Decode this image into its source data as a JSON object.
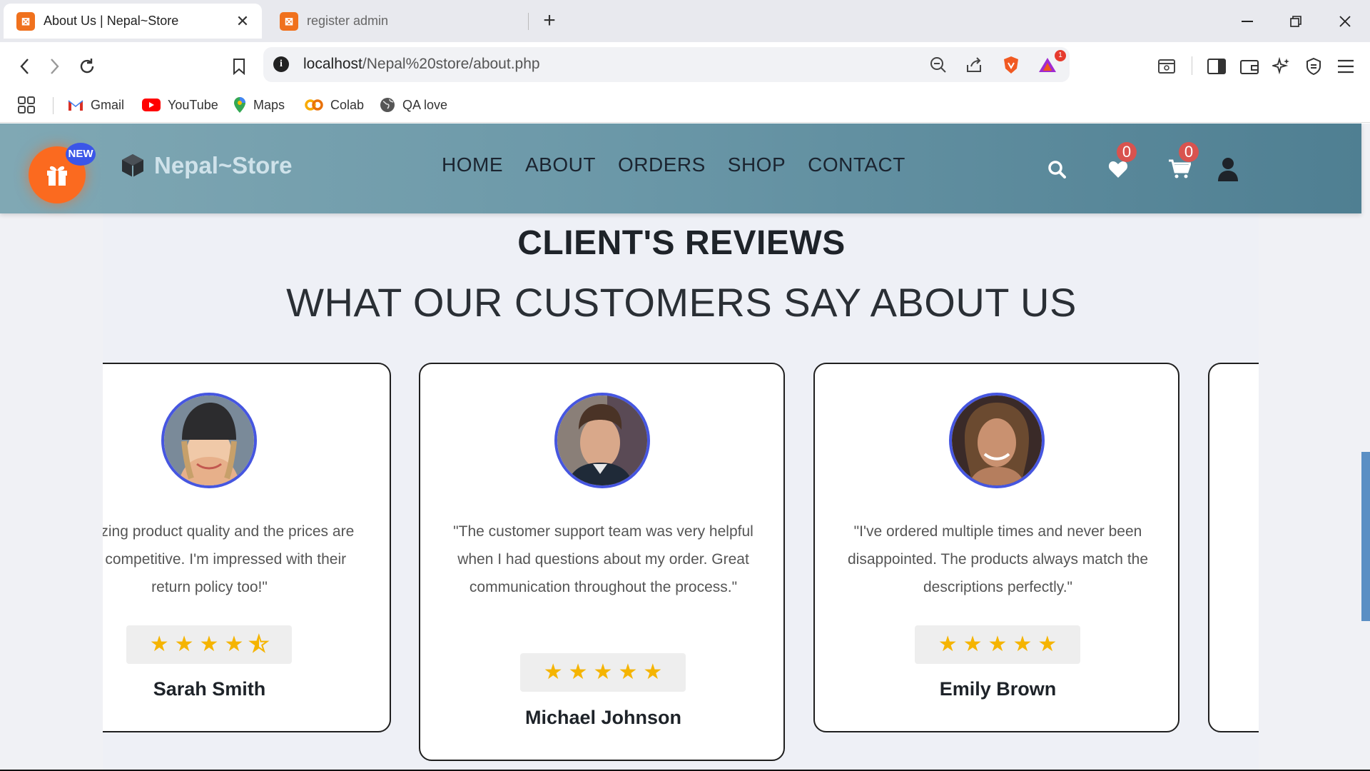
{
  "browser": {
    "tabs": [
      {
        "title": "About Us | Nepal~Store",
        "active": true
      },
      {
        "title": "register admin",
        "active": false
      }
    ],
    "url": {
      "host": "localhost",
      "path": "/Nepal%20store/about.php"
    },
    "brave_rewards_count": "1",
    "bookmarks": [
      "Gmail",
      "YouTube",
      "Maps",
      "Colab",
      "QA love"
    ]
  },
  "site": {
    "gift_badge": "NEW",
    "brand": "Nepal~Store",
    "nav": [
      "HOME",
      "ABOUT",
      "ORDERS",
      "SHOP",
      "CONTACT"
    ],
    "wishlist_count": "0",
    "cart_count": "0"
  },
  "reviews": {
    "heading": "CLIENT'S REVIEWS",
    "subheading": "WHAT OUR CUSTOMERS SAY ABOUT US",
    "items": [
      {
        "name": "Sarah Smith",
        "quote": "\"Amazing product quality and the prices are very competitive. I'm impressed with their return policy too!\"",
        "rating": 4.5
      },
      {
        "name": "Michael Johnson",
        "quote": "\"The customer support team was very helpful when I had questions about my order. Great communication throughout the process.\"",
        "rating": 5
      },
      {
        "name": "Emily Brown",
        "quote": "\"I've ordered multiple times and never been disappointed. The products always match the descriptions perfectly.\"",
        "rating": 5
      }
    ]
  },
  "colors": {
    "accent": "#4656e0",
    "star": "#f5b400",
    "gift": "#fb6a1f",
    "header_start": "#80a8b4",
    "header_end": "#4f7f92"
  }
}
